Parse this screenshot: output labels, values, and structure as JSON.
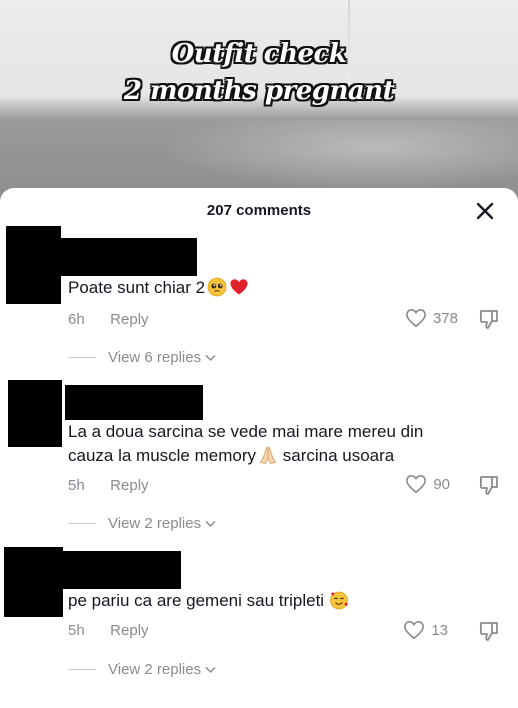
{
  "video": {
    "overlay_line1": "Outfit check",
    "overlay_line2": "2 months pregnant"
  },
  "sheet": {
    "comment_count_label": "207 comments"
  },
  "comments": [
    {
      "text": "Poate sunt chiar 2",
      "emojis": [
        "pleading-face-emoji",
        "red-heart-emoji"
      ],
      "time": "6h",
      "reply_label": "Reply",
      "likes": "378",
      "view_replies": "View 6 replies"
    },
    {
      "text_line1": "La a doua sarcina se vede mai mare mereu din",
      "text_line2_a": "cauza la muscle memory",
      "text_line2_b": " sarcina usoara",
      "emojis": [
        "folded-hands-emoji"
      ],
      "time": "5h",
      "reply_label": "Reply",
      "likes": "90",
      "view_replies": "View 2 replies"
    },
    {
      "text": "pe pariu ca are gemeni sau tripleti",
      "emojis": [
        "smiling-face-with-hearts-emoji"
      ],
      "time": "5h",
      "reply_label": "Reply",
      "likes": "13",
      "view_replies": "View 2 replies"
    }
  ],
  "colors": {
    "text_primary": "#161823",
    "text_secondary": "#8a8b91",
    "heart_emoji": "#e0202c"
  }
}
